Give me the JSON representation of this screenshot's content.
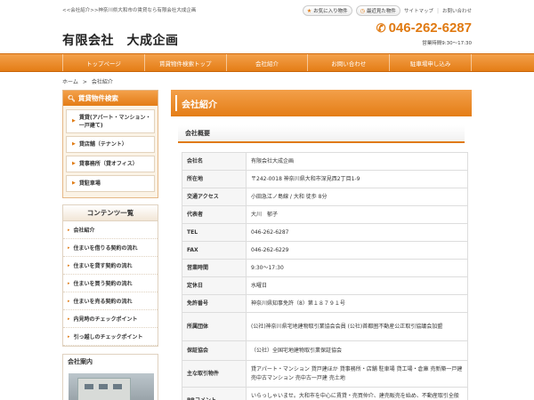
{
  "header": {
    "tagline": "<<会社紹介>>神奈川県大和市の賃貸なら有限会社大成企画",
    "favorites_label": "お気に入り物件",
    "recent_label": "最近見た物件",
    "sitemap_label": "サイトマップ",
    "contact_label": "お問い合わせ",
    "company_name": "有限会社　大成企画",
    "phone": "046-262-6287",
    "hours": "営業時間9:30～17:30"
  },
  "nav": [
    "トップページ",
    "賃貸物件検索トップ",
    "会社紹介",
    "お問い合わせ",
    "駐車場申し込み"
  ],
  "breadcrumb": {
    "home": "ホーム",
    "sep": ">",
    "current": "会社紹介"
  },
  "sidebar": {
    "search_title": "賃貸物件検索",
    "categories": [
      "賃貸(アパート・マンション・一戸建て)",
      "貸店舗（テナント）",
      "貸事務所（貸オフィス）",
      "貸駐車場"
    ],
    "content_title": "コンテンツ一覧",
    "content_items": [
      "会社紹介",
      "住まいを借りる契約の流れ",
      "住まいを貸す契約の流れ",
      "住まいを買う契約の流れ",
      "住まいを売る契約の流れ",
      "内見時のチェックポイント",
      "引っ越しのチェックポイント"
    ],
    "company_title": "会社案内"
  },
  "main": {
    "title": "会社紹介",
    "section": "会社概要",
    "rows": [
      {
        "key": "会社名",
        "value": "有限会社大成企画"
      },
      {
        "key": "所在地",
        "value": "〒242-0018 神奈川県大和市深見西2丁目1-9"
      },
      {
        "key": "交通アクセス",
        "value": "小田急江ノ島線 / 大和 徒歩 8分"
      },
      {
        "key": "代表者",
        "value": "大川　郁子"
      },
      {
        "key": "TEL",
        "value": "046-262-6287"
      },
      {
        "key": "FAX",
        "value": "046-262-6229"
      },
      {
        "key": "営業時間",
        "value": "9:30～17:30"
      },
      {
        "key": "定休日",
        "value": "水曜日"
      },
      {
        "key": "免許番号",
        "value": "神奈川県知事免許（8）第１８７９１号"
      },
      {
        "key": "所属団体",
        "value": "(公社)神奈川県宅地建物取引業協会会員 (公社)首都圏不動産公正取引協議会加盟"
      },
      {
        "key": "保証協会",
        "value": "（公社）全国宅地建物取引業保証協会"
      },
      {
        "key": "主な取引物件",
        "value": "貸アパート・マンション 貸戸建ほか 貸事務所・店舗 駐車場 貸工場・倉庫 売新築一戸建 売中古マンション 売中古一戸建 売土地"
      },
      {
        "key": "PRコメント",
        "value": "いらっしゃいませ。大和市を中心に賃貸・売買仲介、建売販売を始め、不動産取引全般を業務として行っています。親身になってご紹介させて頂きます。"
      }
    ]
  },
  "colors": {
    "accent": "#e47d16",
    "accent_light": "#f3a04a"
  }
}
